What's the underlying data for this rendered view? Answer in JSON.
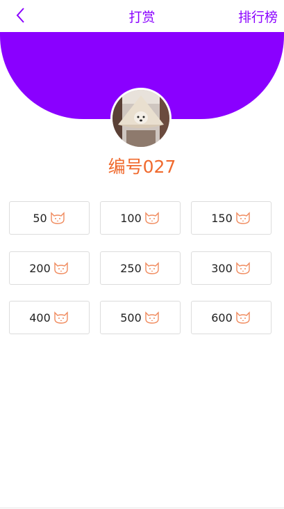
{
  "header": {
    "back_icon": "chevron-left-icon",
    "title": "打赏",
    "ranking_label": "排行榜"
  },
  "profile": {
    "name": "编号027",
    "avatar": "avatar-photo"
  },
  "tip_options": [
    {
      "amount": "50",
      "icon": "cat-icon"
    },
    {
      "amount": "100",
      "icon": "cat-icon"
    },
    {
      "amount": "150",
      "icon": "cat-icon"
    },
    {
      "amount": "200",
      "icon": "cat-icon"
    },
    {
      "amount": "250",
      "icon": "cat-icon"
    },
    {
      "amount": "300",
      "icon": "cat-icon"
    },
    {
      "amount": "400",
      "icon": "cat-icon"
    },
    {
      "amount": "500",
      "icon": "cat-icon"
    },
    {
      "amount": "600",
      "icon": "cat-icon"
    }
  ],
  "colors": {
    "accent": "#8a00ff",
    "name": "#f06a2e",
    "icon": "#f08a5d"
  }
}
